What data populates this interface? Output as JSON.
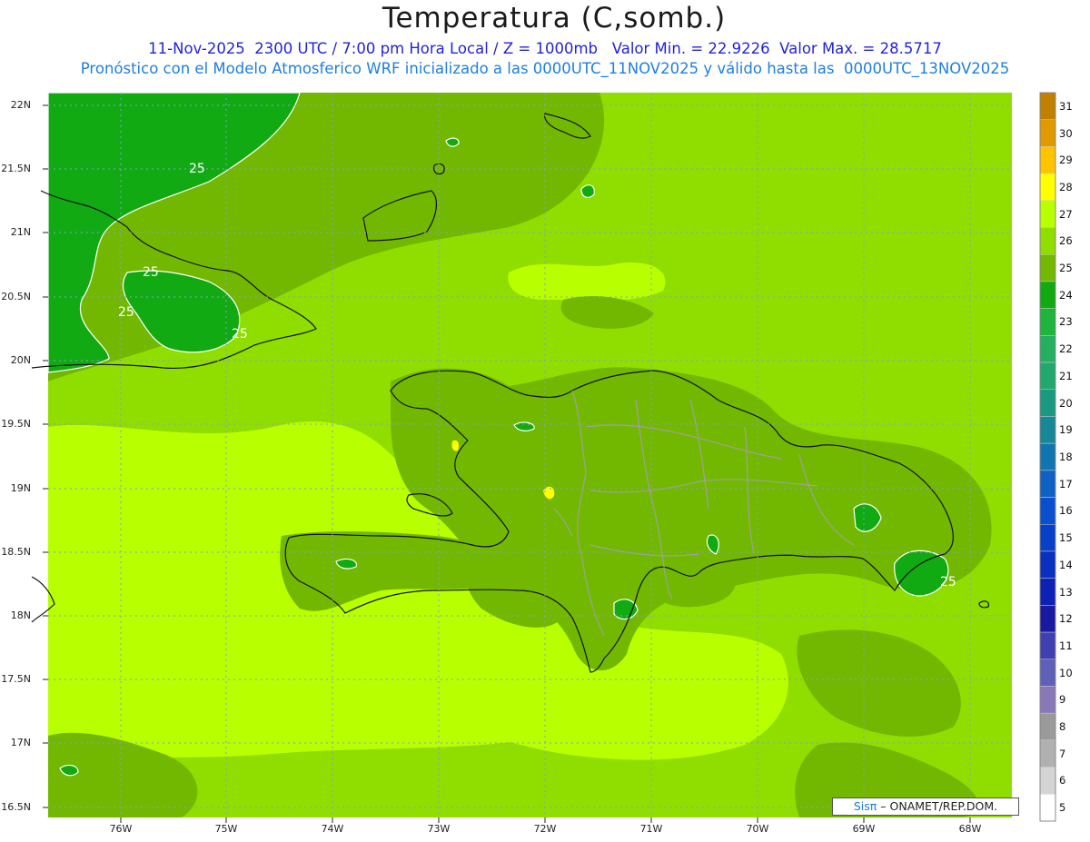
{
  "header": {
    "title": "Temperatura (C,somb.)",
    "line1": "11-Nov-2025  2300 UTC / 7:00 pm Hora Local / Z = 1000mb   Valor Min. = 22.9226  Valor Max. = 28.5717",
    "line2": "Pronóstico con el Modelo Atmosferico WRF inicializado a las 0000UTC_11NOV2025 y válido hasta las  0000UTC_13NOV2025"
  },
  "axes": {
    "lat_labels": [
      "22N",
      "21.5N",
      "21N",
      "20.5N",
      "20N",
      "19.5N",
      "19N",
      "18.5N",
      "18N",
      "17.5N",
      "17N",
      "16.5N"
    ],
    "lon_labels": [
      "76W",
      "75W",
      "74W",
      "73W",
      "72W",
      "71W",
      "70W",
      "69W",
      "68W"
    ]
  },
  "contour_labels": [
    "25",
    "25",
    "25",
    "25",
    "25"
  ],
  "colorbar": {
    "levels": [
      "31",
      "30",
      "29",
      "28",
      "27",
      "26",
      "25",
      "24",
      "23",
      "22",
      "21",
      "20",
      "19",
      "18",
      "17",
      "16",
      "15",
      "14",
      "13",
      "12",
      "11",
      "10",
      "9",
      "8",
      "7",
      "6",
      "5"
    ],
    "colors": [
      "#c08000",
      "#e09a00",
      "#ffc400",
      "#ffff00",
      "#b8ff00",
      "#90dd00",
      "#72b800",
      "#12aa12",
      "#1fb53c",
      "#24b060",
      "#22a86e",
      "#1b9a82",
      "#168896",
      "#1176b0",
      "#0f62c4",
      "#0a50cc",
      "#0840c8",
      "#0a30c0",
      "#0d22b4",
      "#1a1aa0",
      "#4040b0",
      "#6060b8",
      "#8878b8",
      "#9a9a9a",
      "#b0b0b0",
      "#d4d4d4",
      "#ffffff"
    ]
  },
  "credit": {
    "brand": "Sisπ",
    "text": "– ONAMET/REP.DOM."
  }
}
